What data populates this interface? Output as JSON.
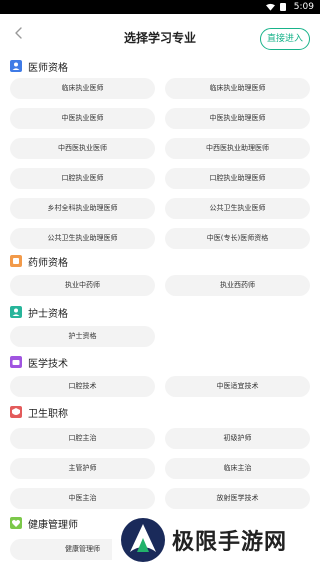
{
  "status": {
    "time": "5:09"
  },
  "header": {
    "title": "选择学习专业",
    "skip_label": "直接进入"
  },
  "sections": [
    {
      "title": "医师资格",
      "icon": "doctor-icon",
      "items": [
        "临床执业医师",
        "临床执业助理医师",
        "中医执业医师",
        "中医执业助理医师",
        "中西医执业医师",
        "中西医执业助理医师",
        "口腔执业医师",
        "口腔执业助理医师",
        "乡村全科执业助理医师",
        "公共卫生执业医师",
        "公共卫生执业助理医师",
        "中医(专长)医师资格"
      ]
    },
    {
      "title": "药师资格",
      "icon": "pharmacist-icon",
      "items": [
        "执业中药师",
        "执业西药师"
      ]
    },
    {
      "title": "护士资格",
      "icon": "nurse-icon",
      "items": [
        "护士资格"
      ]
    },
    {
      "title": "医学技术",
      "icon": "medical-tech-icon",
      "items": [
        "口腔技术",
        "中医适宜技术"
      ]
    },
    {
      "title": "卫生职称",
      "icon": "health-title-icon",
      "items": [
        "口腔主治",
        "初级护师",
        "主管护师",
        "临床主治",
        "中医主治",
        "放射医学技术"
      ]
    },
    {
      "title": "健康管理师",
      "icon": "health-manager-icon",
      "items": [
        "健康管理师"
      ]
    }
  ],
  "watermark": {
    "text": "极限手游网"
  },
  "colors": {
    "accent": "#18b38a",
    "chip_bg": "#f3f3f3"
  }
}
